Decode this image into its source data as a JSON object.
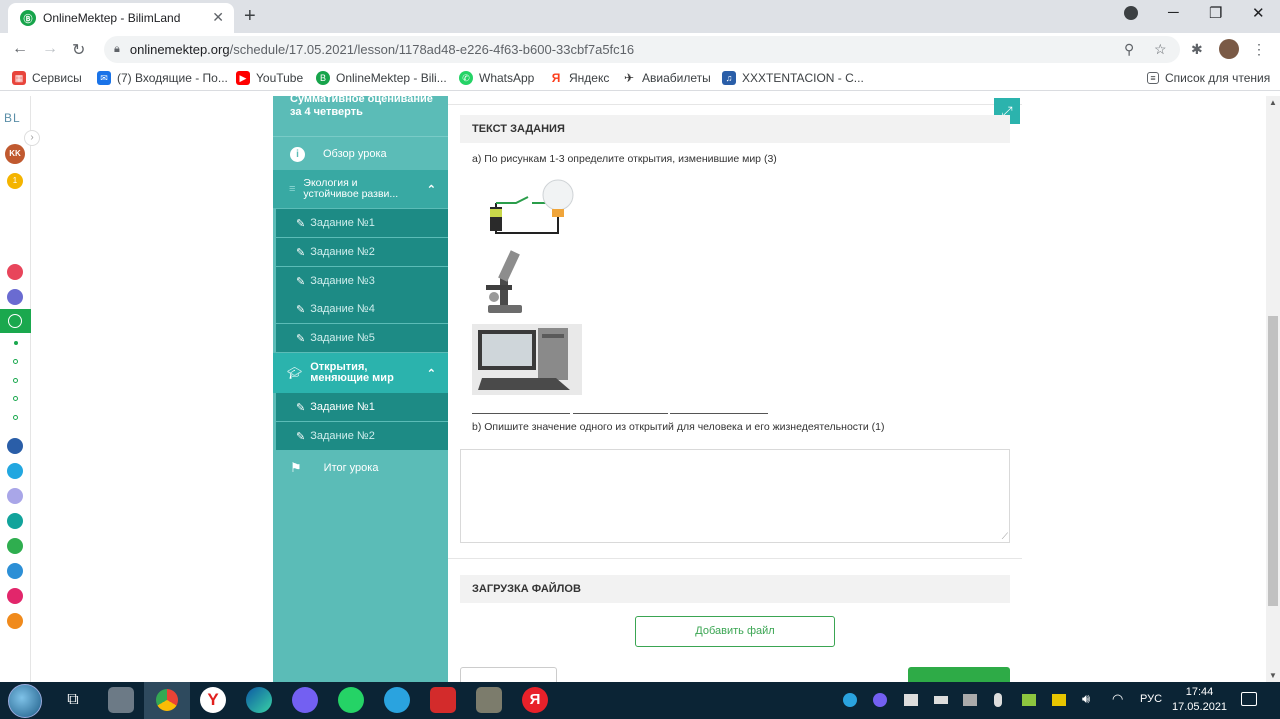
{
  "browser": {
    "tab_title": "OnlineMektep - BilimLand",
    "url_host": "onlinemektep.org",
    "url_path": "/schedule/17.05.2021/lesson/1178ad48-e226-4f63-b600-33cbf7a5fc16",
    "bookmarks": [
      {
        "label": "Сервисы",
        "color": "#e8453c"
      },
      {
        "label": "(7) Входящие - По...",
        "color": "#1a73e8"
      },
      {
        "label": "YouTube",
        "color": "#ff0000"
      },
      {
        "label": "OnlineMektep - Bili...",
        "color": "#17a44b"
      },
      {
        "label": "WhatsApp",
        "color": "#25d366"
      },
      {
        "label": "Яндекс",
        "color": "#fc3f1d"
      },
      {
        "label": "Авиабилеты",
        "color": "#333333"
      },
      {
        "label": "XXXTENTACION - С...",
        "color": "#2a5ea8"
      }
    ],
    "reading_list": "Список для чтения"
  },
  "rail": {
    "logo": "BL",
    "user": "KK",
    "badge": "1"
  },
  "sidebar": {
    "heading": "Суммативное оценивание за 4 четверть",
    "overview": "Обзор урока",
    "section1": "Экология и устойчивое разви...",
    "section1_items": [
      "Задание №1",
      "Задание №2",
      "Задание №3",
      "Задание №4",
      "Задание №5"
    ],
    "section2": "Открытия, меняющие мир",
    "section2_items": [
      "Задание №1",
      "Задание №2"
    ],
    "summary": "Итог урока"
  },
  "task": {
    "header": "ТЕКСТ ЗАДАНИЯ",
    "question_a": "a) По рисункам 1-3 определите открытия, изменившие мир (3)",
    "question_b": "b) Опишите значение одного из открытий для человека и его жизнедеятельности (1)",
    "images": [
      "lightbulb-circuit",
      "microscope",
      "computer"
    ]
  },
  "upload": {
    "header": "ЗАГРУЗКА ФАЙЛОВ",
    "button": "Добавить файл"
  },
  "taskbar": {
    "lang": "РУС",
    "time": "17:44",
    "date": "17.05.2021"
  },
  "colors": {
    "teal": "#5bbcb7",
    "teal_dark": "#1d8b85",
    "green": "#17a44b"
  }
}
